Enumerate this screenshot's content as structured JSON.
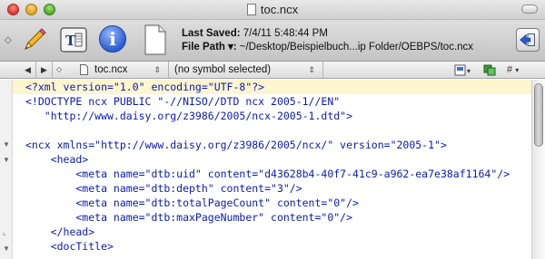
{
  "window": {
    "title": "toc.ncx"
  },
  "toolbar": {
    "last_saved_label": "Last Saved:",
    "last_saved_value": "7/4/11 5:48:44 PM",
    "file_path_label": "File Path",
    "file_path_menu_glyph": "▾",
    "file_path_value": "~/Desktop/Beispielbuch...ip Folder/OEBPS/toc.ncx",
    "icons": [
      "pencil-icon",
      "text-selection-icon",
      "info-icon",
      "document-icon",
      "back-arrow-icon"
    ]
  },
  "navbar": {
    "back_glyph": "◀",
    "forward_glyph": "▶",
    "file_name": "toc.ncx",
    "symbol_selection": "(no symbol selected)",
    "hash_label": "#"
  },
  "code": {
    "lines": [
      {
        "t": "<?xml version=\"1.0\" encoding=\"UTF-8\"?>",
        "hl": true
      },
      {
        "t": "<!DOCTYPE ncx PUBLIC \"-//NISO//DTD ncx 2005-1//EN\""
      },
      {
        "t": "   \"http://www.daisy.org/z3986/2005/ncx-2005-1.dtd\">"
      },
      {
        "t": ""
      },
      {
        "t": "<ncx xmlns=\"http://www.daisy.org/z3986/2005/ncx/\" version=\"2005-1\">"
      },
      {
        "t": "    <head>"
      },
      {
        "t": "        <meta name=\"dtb:uid\" content=\"d43628b4-40f7-41c9-a962-ea7e38af1164\"/>"
      },
      {
        "t": "        <meta name=\"dtb:depth\" content=\"3\"/>"
      },
      {
        "t": "        <meta name=\"dtb:totalPageCount\" content=\"0\"/>"
      },
      {
        "t": "        <meta name=\"dtb:maxPageNumber\" content=\"0\"/>"
      },
      {
        "t": "    </head>"
      },
      {
        "t": "    <docTitle>"
      }
    ]
  },
  "colors": {
    "highlight_line": "#fdf6cf",
    "code_text": "#0a19b8"
  }
}
